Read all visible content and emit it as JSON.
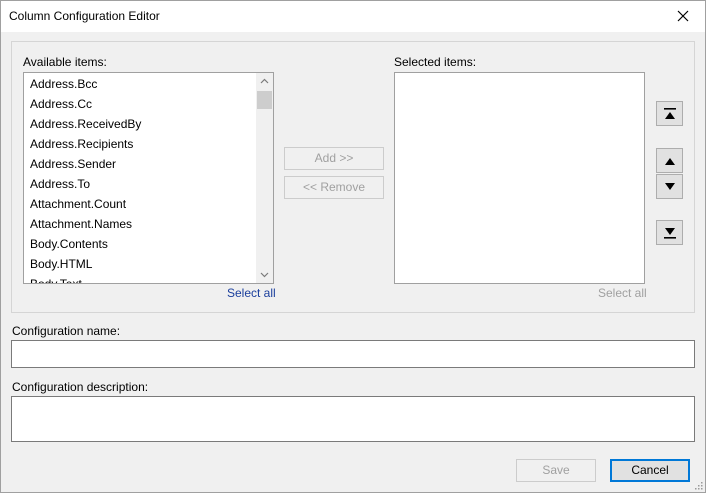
{
  "window": {
    "title": "Column Configuration Editor"
  },
  "available": {
    "label": "Available items:",
    "items": [
      "Address.Bcc",
      "Address.Cc",
      "Address.ReceivedBy",
      "Address.Recipients",
      "Address.Sender",
      "Address.To",
      "Attachment.Count",
      "Attachment.Names",
      "Body.Contents",
      "Body.HTML",
      "Body.Text"
    ],
    "select_all": "Select all"
  },
  "selected": {
    "label": "Selected items:",
    "items": [],
    "select_all": "Select all"
  },
  "transfer": {
    "add": "Add >>",
    "remove": "<< Remove"
  },
  "config_name": {
    "label": "Configuration name:",
    "value": ""
  },
  "config_description": {
    "label": "Configuration description:",
    "value": ""
  },
  "footer": {
    "save": "Save",
    "cancel": "Cancel"
  },
  "colors": {
    "link": "#1a3e9c",
    "disabled_text": "#a0a0a0",
    "focus_border": "#0078d7"
  },
  "icons": [
    "close-icon",
    "move-top-icon",
    "move-up-icon",
    "move-down-icon",
    "move-bottom-icon",
    "scroll-up-icon",
    "scroll-down-icon",
    "resize-grip-icon"
  ]
}
